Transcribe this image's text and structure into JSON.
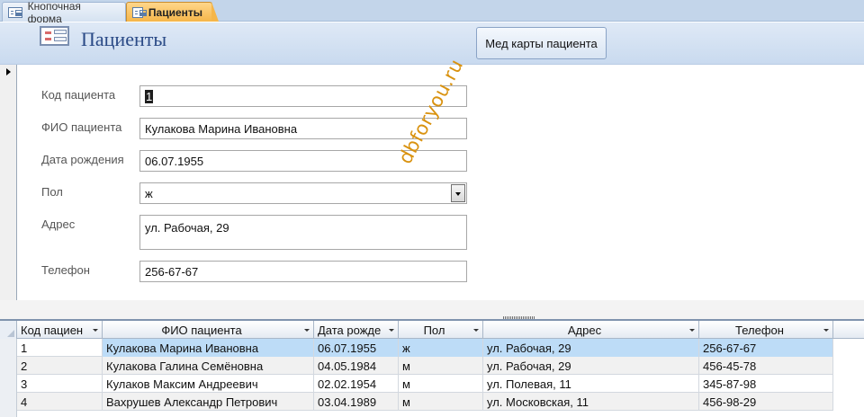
{
  "tabs": [
    {
      "label": "Кнопочная форма",
      "active": false
    },
    {
      "label": "Пациенты",
      "active": true
    }
  ],
  "header": {
    "title": "Пациенты",
    "button_label": "Мед карты пациента"
  },
  "fields": [
    {
      "label": "Код пациента",
      "value": "1"
    },
    {
      "label": "ФИО пациента",
      "value": "Кулакова Марина Ивановна"
    },
    {
      "label": "Дата рождения",
      "value": "06.07.1955"
    },
    {
      "label": "Пол",
      "value": "ж"
    },
    {
      "label": "Адрес",
      "value": "ул. Рабочая, 29"
    },
    {
      "label": "Телефон",
      "value": "256-67-67"
    }
  ],
  "watermark": "dbforyou.ru",
  "datasheet": {
    "columns": [
      "Код пациен",
      "ФИО пациента",
      "Дата рожде",
      "Пол",
      "Адрес",
      "Телефон"
    ],
    "rows": [
      [
        "1",
        "Кулакова Марина Ивановна",
        "06.07.1955",
        "ж",
        "ул. Рабочая, 29",
        "256-67-67"
      ],
      [
        "2",
        "Кулакова Галина Семёновна",
        "04.05.1984",
        "м",
        "ул. Рабочая, 29",
        "456-45-78"
      ],
      [
        "3",
        "Кулаков Максим Андреевич",
        "02.02.1954",
        "м",
        "ул. Полевая, 11",
        "345-87-98"
      ],
      [
        "4",
        "Вахрушев Александр Петрович",
        "03.04.1989",
        "м",
        "ул. Московская, 11",
        "456-98-29"
      ]
    ]
  },
  "colors": {
    "header_gradient_top": "#dfe9f6",
    "title_color": "#2a4a86",
    "active_tab": "#f5b64a",
    "selected_row": "#bddcf7",
    "watermark": "#d9920f"
  }
}
